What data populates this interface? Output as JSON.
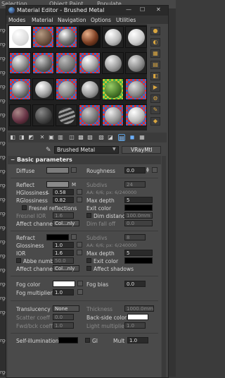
{
  "background_app": {
    "tabs": [
      "Selection",
      "Object Paint",
      "Populate"
    ],
    "side_labels": [
      "rge",
      "rge",
      "rge",
      "rge",
      "rge",
      "rge",
      "rge",
      "rge",
      "rge",
      "rge",
      "rge",
      "rge",
      "rge",
      "rge",
      "rge",
      "rge",
      "rge",
      "rge",
      "rge",
      "rge",
      "rge",
      "rge",
      "rget"
    ]
  },
  "window": {
    "title": "Material Editor - Brushed Metal",
    "controls": [
      "—",
      "☐",
      "✕"
    ]
  },
  "menu": [
    "Modes",
    "Material",
    "Navigation",
    "Options",
    "Utilities"
  ],
  "material": {
    "name": "Brushed Metal",
    "type": "VRayMtl"
  },
  "basic_parameters": {
    "header": "Basic parameters",
    "diffuse": {
      "label": "Diffuse",
      "roughness_label": "Roughness",
      "roughness": "0.0"
    },
    "reflect": {
      "label": "Reflect",
      "m": "M",
      "subdivs_label": "Subdivs",
      "subdivs": "24",
      "hglossiness_label": "HGlossiness",
      "hglossiness": "0.58",
      "l": "L",
      "aa_label": "AA: 6/6; px: 6/240000",
      "rglossiness_label": "RGlossiness",
      "rglossiness": "0.82",
      "max_depth_label": "Max depth",
      "max_depth": "5",
      "fresnel_label": "Fresnel reflections",
      "exit_color_label": "Exit color",
      "fresnel_ior_label": "Fresnel IOR",
      "fresnel_ior": "1.6",
      "dim_distance_label": "Dim distance",
      "dim_distance": "100.0mm",
      "affect_label": "Affect channels",
      "affect": "Col...nly",
      "dim_falloff_label": "Dim fall off",
      "dim_falloff": "0.0"
    },
    "refract": {
      "label": "Refract",
      "subdivs_label": "Subdivs",
      "subdivs": "8",
      "glossiness_label": "Glossiness",
      "glossiness": "1.0",
      "aa_label": "AA: 6/6; px: 6/240000",
      "ior_label": "IOR",
      "ior": "1.6",
      "max_depth_label": "Max depth",
      "max_depth": "5",
      "abbe_label": "Abbe number",
      "abbe": "50.0",
      "exit_color_label": "Exit color",
      "affect_label": "Affect channels",
      "affect": "Col...nly",
      "affect_shadows_label": "Affect shadows"
    },
    "fog": {
      "color_label": "Fog color",
      "bias_label": "Fog bias",
      "bias": "0.0",
      "multiplier_label": "Fog multiplier",
      "multiplier": "1.0"
    },
    "translucency": {
      "label": "Translucency",
      "value": "None",
      "thickness_label": "Thickness",
      "thickness": "1000.0mm",
      "scatter_label": "Scatter coeff",
      "scatter": "0.0",
      "backside_label": "Back-side color",
      "fwd_label": "Fwd/bck coeff",
      "fwd": "1.0",
      "light_mult_label": "Light multiplier",
      "light_mult": "1.0"
    },
    "self_illum": {
      "label": "Self-illumination",
      "gi_label": "GI",
      "mult_label": "Mult",
      "mult": "1.0"
    }
  },
  "colors": {
    "accent": "#d9a640",
    "window_bg": "#444444"
  }
}
